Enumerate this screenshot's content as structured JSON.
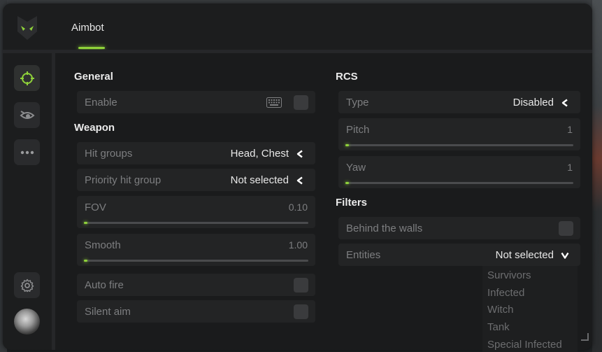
{
  "header": {
    "active_tab": "Aimbot"
  },
  "sidebar": {
    "items": [
      {
        "icon": "crosshair-icon",
        "active": true
      },
      {
        "icon": "eye-icon"
      },
      {
        "icon": "more-icon"
      }
    ],
    "bottom": [
      {
        "icon": "gear-icon"
      },
      {
        "icon": "avatar"
      }
    ]
  },
  "general": {
    "title": "General",
    "enable": {
      "label": "Enable",
      "checked": false
    }
  },
  "weapon": {
    "title": "Weapon",
    "hit_groups": {
      "label": "Hit groups",
      "value": "Head, Chest"
    },
    "priority": {
      "label": "Priority hit group",
      "value": "Not selected"
    },
    "fov": {
      "label": "FOV",
      "value": "0.10",
      "fraction": 0.01
    },
    "smooth": {
      "label": "Smooth",
      "value": "1.00",
      "fraction": 0.01
    },
    "auto_fire": {
      "label": "Auto fire",
      "checked": false
    },
    "silent_aim": {
      "label": "Silent aim",
      "checked": false
    }
  },
  "rcs": {
    "title": "RCS",
    "type": {
      "label": "Type",
      "value": "Disabled"
    },
    "pitch": {
      "label": "Pitch",
      "value": "1",
      "fraction": 0.01
    },
    "yaw": {
      "label": "Yaw",
      "value": "1",
      "fraction": 0.01
    }
  },
  "filters": {
    "title": "Filters",
    "behind_walls": {
      "label": "Behind the walls",
      "checked": false
    },
    "entities": {
      "label": "Entities",
      "value": "Not selected",
      "options": [
        "Survivors",
        "Infected",
        "Witch",
        "Tank",
        "Special Infected"
      ]
    }
  },
  "colors": {
    "accent": "#8fd23a",
    "panel": "#1a1b1c",
    "row": "#232425"
  }
}
